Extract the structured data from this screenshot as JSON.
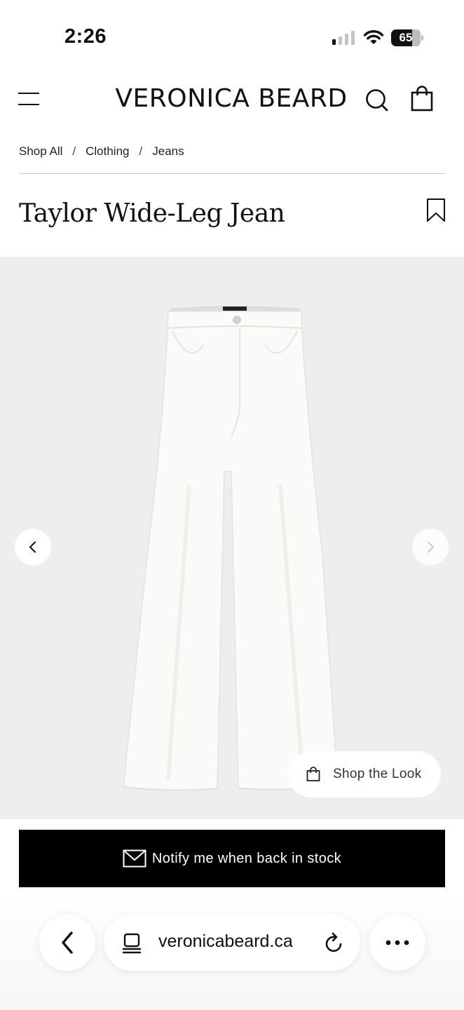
{
  "status_bar": {
    "time": "2:26",
    "battery": "65",
    "signal_bars_on": 1,
    "signal_bars_total": 4
  },
  "header": {
    "brand": "VERONICA BEARD",
    "icons": [
      "menu-icon",
      "search-icon",
      "shopping-bag-icon"
    ]
  },
  "breadcrumb": {
    "items": [
      "Shop All",
      "Clothing",
      "Jeans"
    ],
    "separator": "/"
  },
  "product": {
    "title": "Taylor Wide-Leg Jean",
    "bookmark_icon": "bookmark-icon",
    "image_subject": "white wide-leg jeans"
  },
  "gallery": {
    "prev_icon": "chevron-left-icon",
    "next_icon": "chevron-right-icon",
    "shop_the_look_label": "Shop the Look",
    "background": "#eeeeee"
  },
  "notify": {
    "label": "Notify me when back in stock",
    "icon": "envelope-icon",
    "background": "#000000"
  },
  "browser": {
    "url": "veronicabeard.ca",
    "icons": [
      "back-chevron-icon",
      "tabs-icon",
      "reload-icon",
      "more-dots-icon"
    ]
  }
}
